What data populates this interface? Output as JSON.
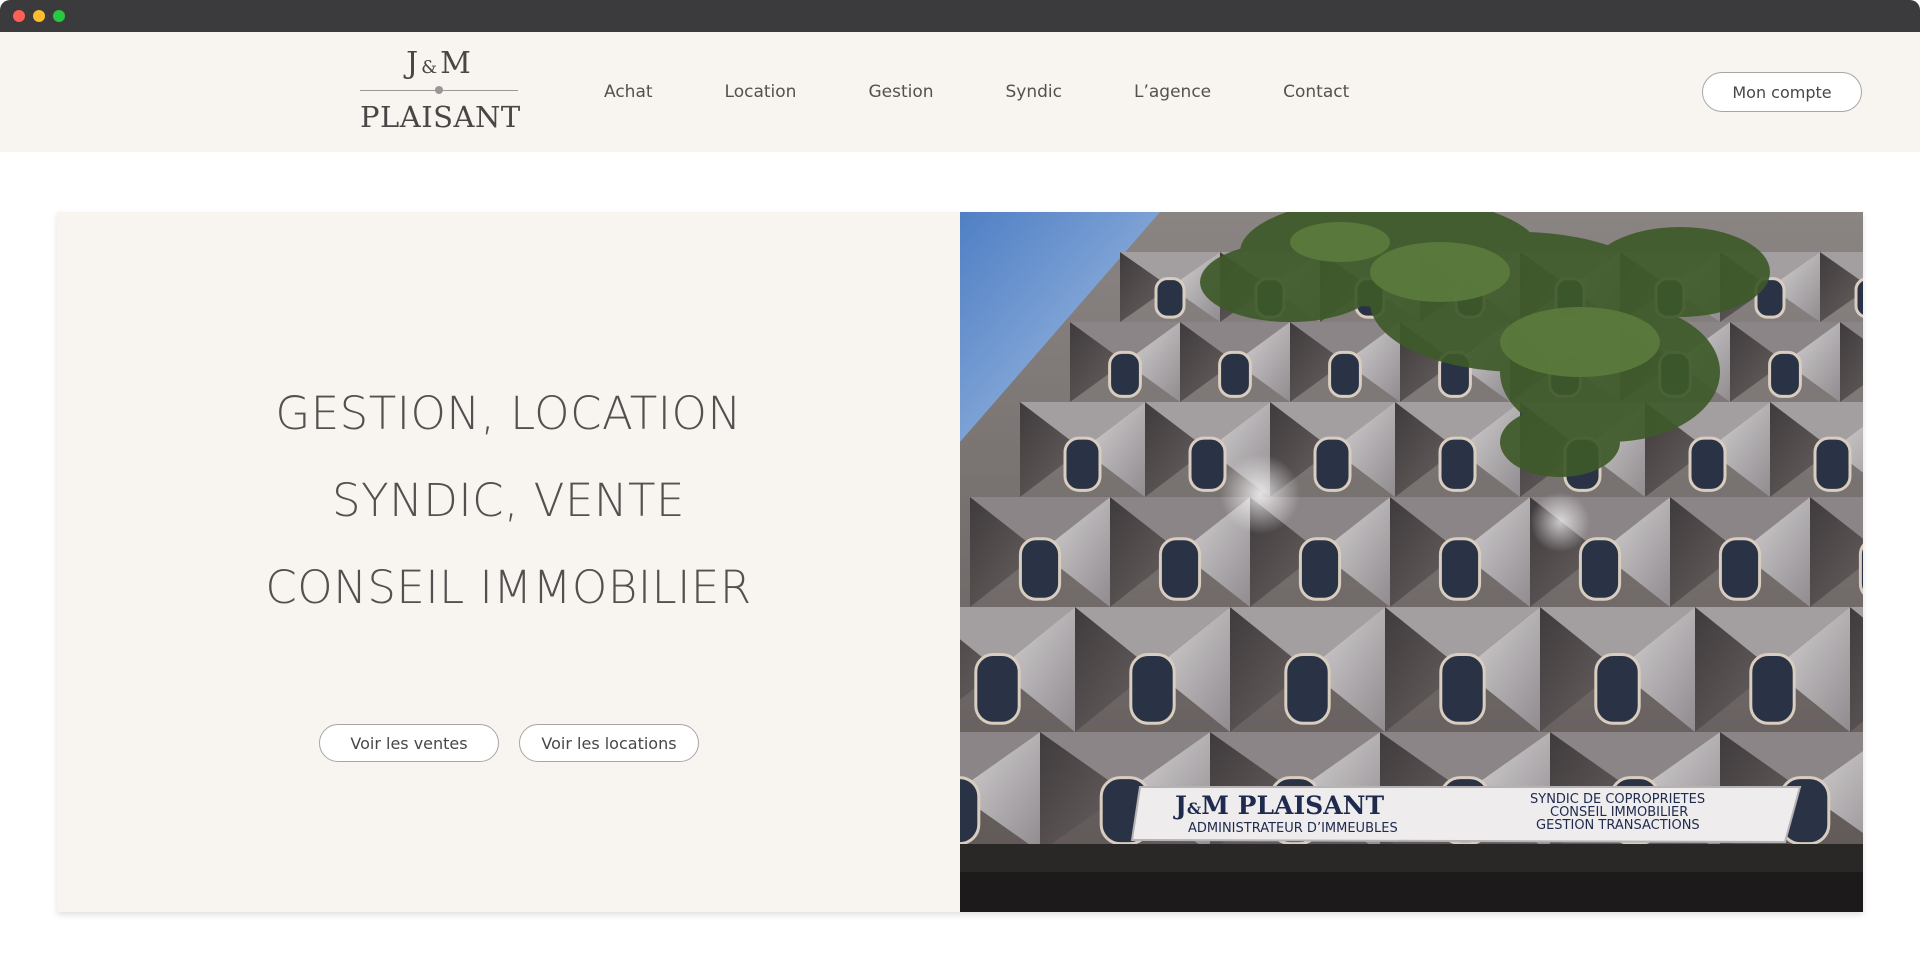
{
  "logo": {
    "line1_left": "J",
    "line1_amp": "&",
    "line1_right": "M",
    "line2": "PLAISANT"
  },
  "nav": {
    "items": [
      {
        "label": "Achat"
      },
      {
        "label": "Location"
      },
      {
        "label": "Gestion"
      },
      {
        "label": "Syndic"
      },
      {
        "label": "L’agence"
      },
      {
        "label": "Contact"
      }
    ]
  },
  "account": {
    "label": "Mon compte"
  },
  "hero": {
    "headline": [
      "GESTION, LOCATION",
      "SYNDIC, VENTE",
      "CONSEIL IMMOBILIER"
    ],
    "buttons": {
      "sales": "Voir les ventes",
      "rentals": "Voir les locations"
    }
  },
  "photo_sign": {
    "brand_left": "J",
    "brand_amp": "&",
    "brand_right": "M  PLAISANT",
    "subtitle": "ADMINISTRATEUR D’IMMEUBLES",
    "services": [
      "SYNDIC DE COPROPRIETES",
      "CONSEIL IMMOBILIER",
      "GESTION TRANSACTIONS"
    ]
  },
  "colors": {
    "header_bg": "#f8f5f1",
    "text": "#4a4646",
    "border": "#aaa5a5"
  }
}
